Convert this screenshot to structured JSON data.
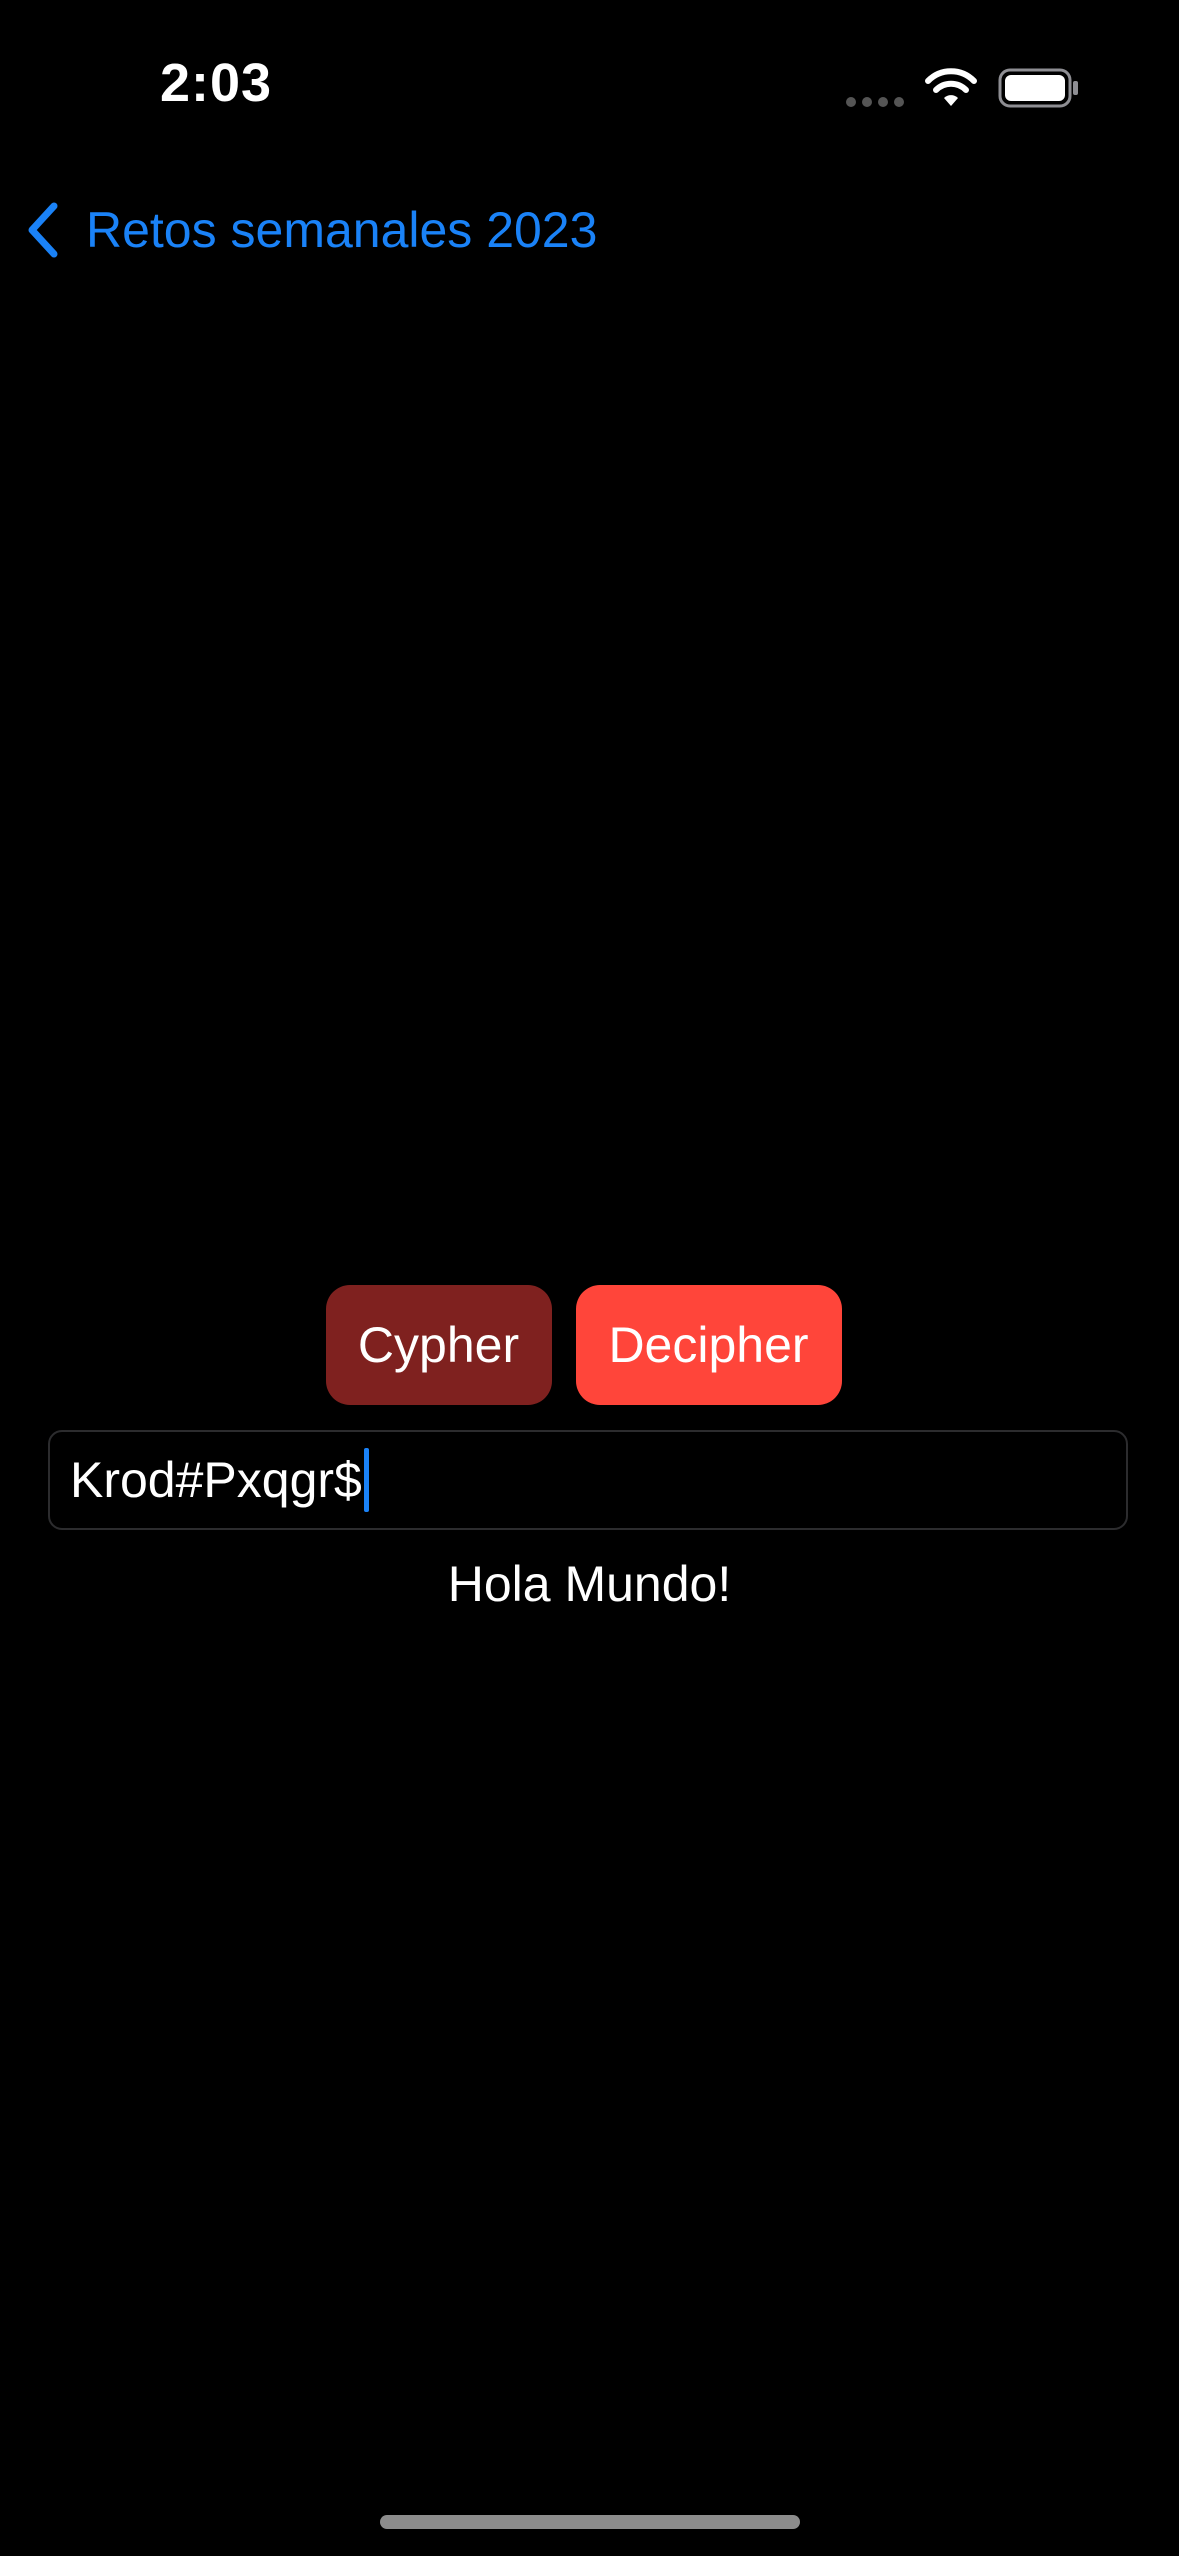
{
  "status_bar": {
    "time": "2:03"
  },
  "navigation": {
    "back_label": "Retos semanales 2023"
  },
  "actions": {
    "cypher_label": "Cypher",
    "decipher_label": "Decipher"
  },
  "input": {
    "value": "Krod#Pxqgr$"
  },
  "result": {
    "text": "Hola Mundo!"
  },
  "colors": {
    "accent": "#1a82f7",
    "cypher_button": "#7f211f",
    "decipher_button": "#ff453a",
    "background": "#000000"
  }
}
